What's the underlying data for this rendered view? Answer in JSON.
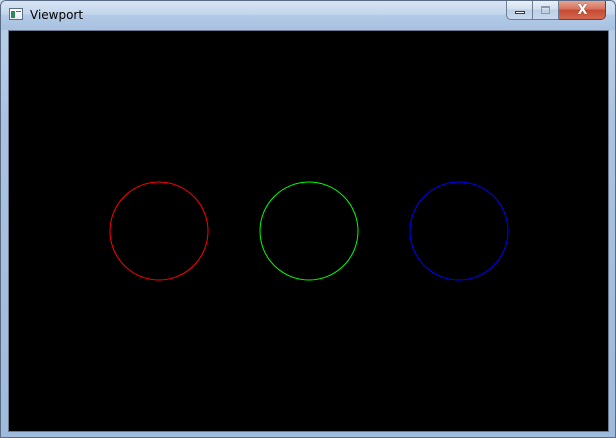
{
  "window": {
    "title": "Viewport"
  },
  "caption_buttons": {
    "close_glyph": "X"
  },
  "circles": [
    {
      "name": "red",
      "color": "#ff0000"
    },
    {
      "name": "green",
      "color": "#00ff00"
    },
    {
      "name": "blue",
      "color": "#0000ff"
    }
  ],
  "viewport": {
    "background": "#000000"
  }
}
